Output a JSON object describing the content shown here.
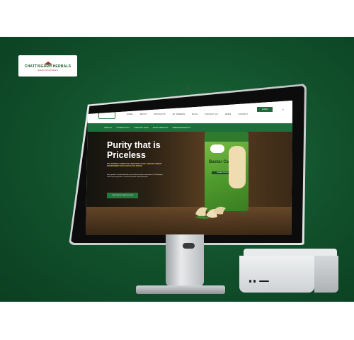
{
  "logo": {
    "name": "CHATTISGARH HERBALS",
    "tagline": "Quality Forest Products"
  },
  "site": {
    "nav_links": [
      "HOME",
      "ABOUT",
      "PRODUCTS",
      "MY ORDERS",
      "BLOG",
      "CONTACT US",
      "NEWS",
      "CONTACT"
    ],
    "login_label": "LOGIN",
    "categories": [
      "SHOP ALL",
      "COSMETOLOGY",
      "FORESTRY FOOD",
      "EXTRA PRODUCTS",
      "PREMIUM PRODUCTS"
    ],
    "hero": {
      "title": "Purity that is Priceless",
      "subtitle": "ECO-FRIENDLY PRODUCTS FROM ONE OF THE LARGEST HONEST ENVIRONMENT OFFLIGHTS IN THE WORLD",
      "body": "Every product is handcrafted with care and love by tribal communities of Chhattisgarh, ensuring every product is enhanced by finest natural principles.",
      "button_label": "JOIN THE ECO REVOLUTION"
    },
    "pack": {
      "brand": "CHATTISGARH HERBALS",
      "product": "Bastar Cashew",
      "tag": "ORGANIC PRODUCT"
    }
  },
  "colors": {
    "stage_green": "#11502b",
    "brand_green": "#1d6b3a"
  }
}
